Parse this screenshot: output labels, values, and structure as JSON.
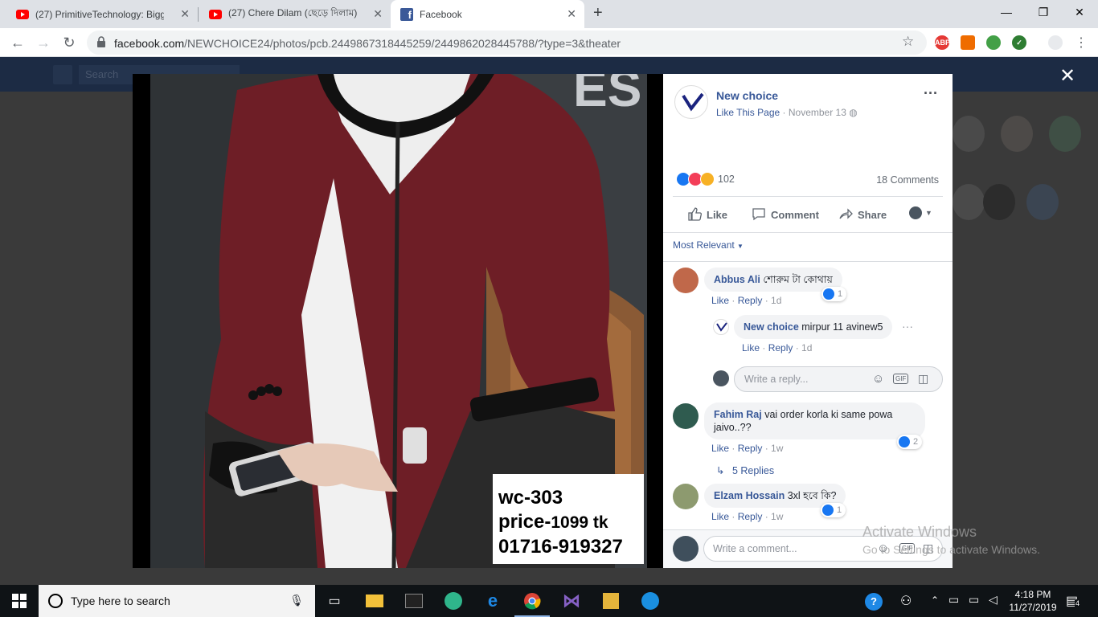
{
  "browser": {
    "tabs": [
      {
        "label": "(27) PrimitiveTechnology: Biggest",
        "icon": "youtube-icon"
      },
      {
        "label": "(27) Chere Dilam (ছেড়ে দিলাম) | F",
        "icon": "youtube-icon"
      },
      {
        "label": "Facebook",
        "icon": "facebook-icon"
      }
    ],
    "url_domain": "facebook.com",
    "url_path": "/NEWCHOICE24/photos/pcb.2449867318445259/2449862028445788/?type=3&theater",
    "extensions": [
      {
        "name": "adblock-icon",
        "badge": "2",
        "color": "#e53935"
      },
      {
        "name": "extension-orange-icon",
        "badge": "",
        "color": "#ef6c00"
      },
      {
        "name": "extension-globe-icon",
        "badge": "",
        "color": "#43a047"
      },
      {
        "name": "extension-check-icon",
        "badge": "0",
        "color": "#2e7d32"
      }
    ]
  },
  "fb_header": {
    "search_placeholder": "Search"
  },
  "photo": {
    "caption_lines": [
      "wc-303",
      "price-",
      "1099 tk",
      "01716-919327"
    ],
    "bg_letters": "ES"
  },
  "post": {
    "page_name": "New choice",
    "like_page": "Like This Page",
    "date": "November 13",
    "reaction_count": "102",
    "comments_count": "18 Comments",
    "actions": {
      "like": "Like",
      "comment": "Comment",
      "share": "Share"
    },
    "sort": "Most Relevant"
  },
  "comments": [
    {
      "author": "Abbus Ali",
      "text": "শোরুম টা কোথায়",
      "like": "Like",
      "reply": "Reply",
      "time": "1d",
      "likes": "1"
    },
    {
      "author": "New choice",
      "text": "mirpur 11 avinew5",
      "like": "Like",
      "reply": "Reply",
      "time": "1d",
      "is_reply": true
    },
    {
      "author": "Fahim Raj",
      "text": "vai order korla ki same powa jaivo..??",
      "like": "Like",
      "reply": "Reply",
      "time": "1w",
      "likes": "2"
    },
    {
      "author": "Elzam Hossain",
      "text": "3xl হবে কি?",
      "like": "Like",
      "reply": "Reply",
      "time": "1w",
      "likes": "1"
    }
  ],
  "reply_placeholder": "Write a reply...",
  "more_replies": "5 Replies",
  "comment_placeholder": "Write a comment...",
  "watermark": {
    "line1": "Activate Windows",
    "line2": "Go to Settings to activate Windows."
  },
  "taskbar": {
    "search_placeholder": "Type here to search",
    "time": "4:18 PM",
    "date": "11/27/2019",
    "notifications": "4"
  }
}
